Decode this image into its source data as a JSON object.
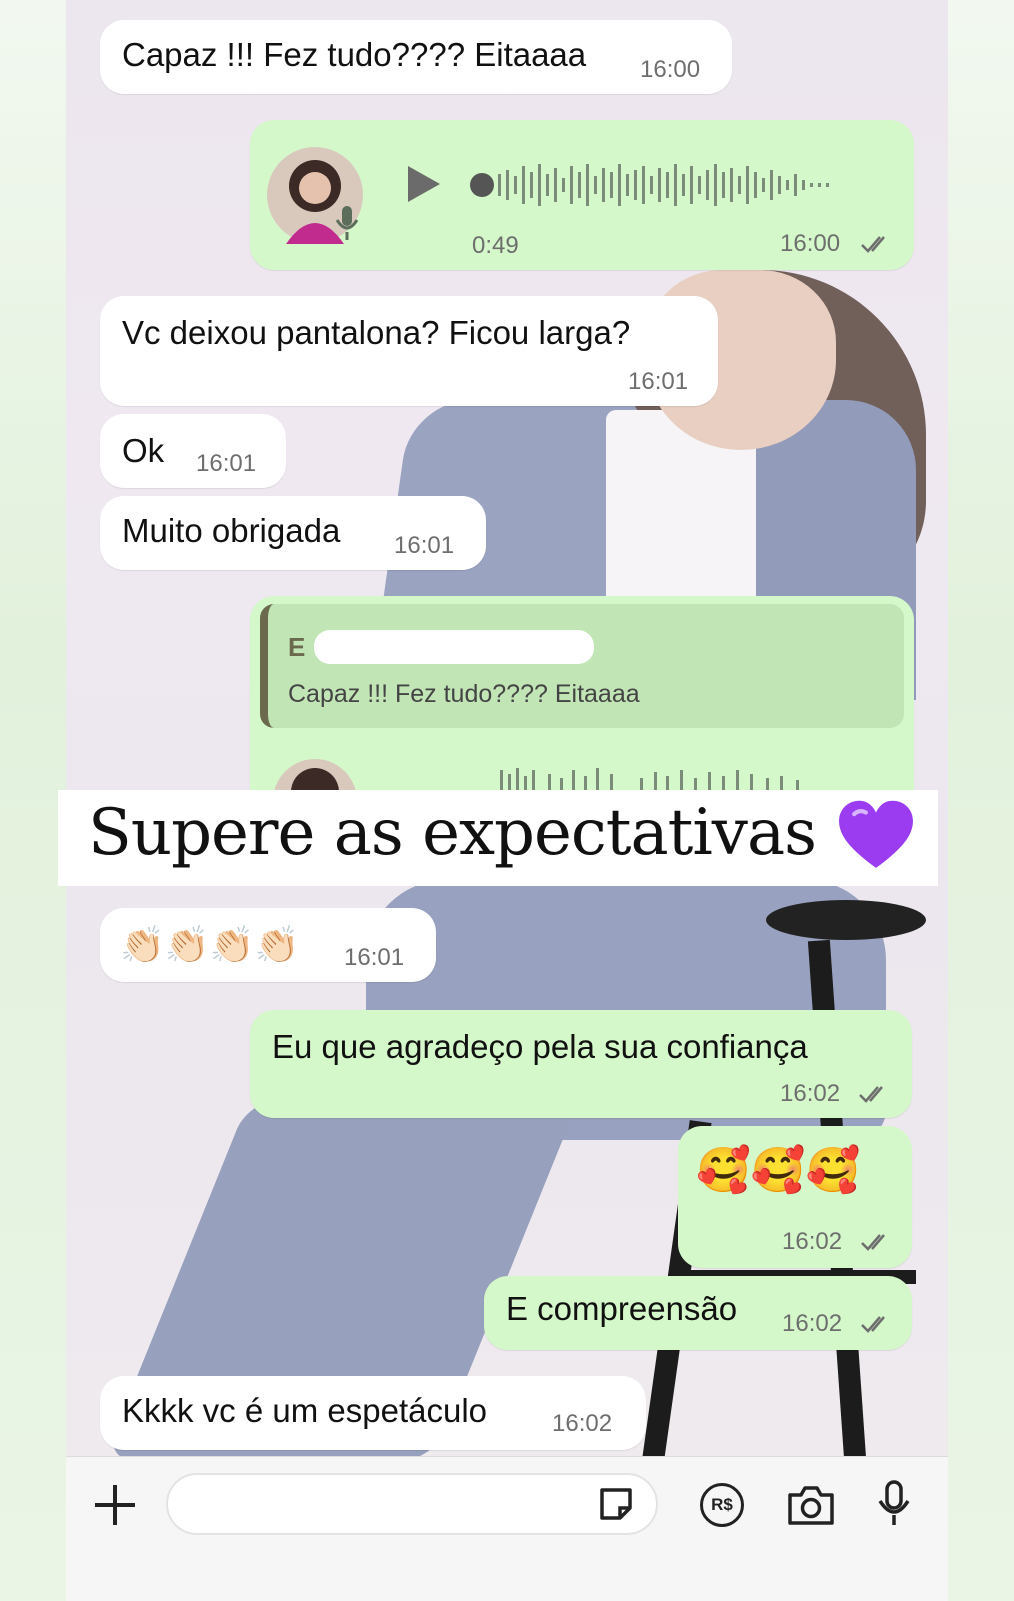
{
  "messages": [
    {
      "id": "m1",
      "direction": "in",
      "text": "Capaz !!! Fez tudo???? Eitaaaa",
      "time": "16:00"
    },
    {
      "id": "m2",
      "direction": "out",
      "type": "voice",
      "duration": "0:49",
      "time": "16:00"
    },
    {
      "id": "m3",
      "direction": "in",
      "text": "Vc deixou pantalona? Ficou larga?",
      "time": "16:01"
    },
    {
      "id": "m4",
      "direction": "in",
      "text": "Ok",
      "time": "16:01"
    },
    {
      "id": "m5",
      "direction": "in",
      "text": "Muito obrigada",
      "time": "16:01"
    },
    {
      "id": "m6",
      "direction": "out",
      "type": "reply-voice",
      "quoted_sender": "E",
      "quoted_text": "Capaz !!! Fez tudo???? Eitaaaa"
    },
    {
      "id": "m7",
      "direction": "in",
      "text": "👏🏻👏🏻👏🏻👏🏻",
      "time": "16:01"
    },
    {
      "id": "m8",
      "direction": "out",
      "text": "Eu que agradeço pela sua confiança",
      "time": "16:02"
    },
    {
      "id": "m9",
      "direction": "out",
      "text": "🥰🥰🥰",
      "time": "16:02"
    },
    {
      "id": "m10",
      "direction": "out",
      "text": "E compreensão",
      "time": "16:02"
    },
    {
      "id": "m11",
      "direction": "in",
      "text": "Kkkk vc é um espetáculo",
      "time": "16:02"
    }
  ],
  "banner": {
    "text": "Supere as expectativas"
  },
  "composer": {
    "icons": [
      "plus-icon",
      "sticker-icon",
      "payment-icon",
      "camera-icon",
      "microphone-icon"
    ],
    "payment_label": "R$"
  },
  "colors": {
    "incoming": "#ffffff",
    "outgoing": "#d4f8c9",
    "tick": "#6e6e6e",
    "heart": "#9b3cf0"
  }
}
